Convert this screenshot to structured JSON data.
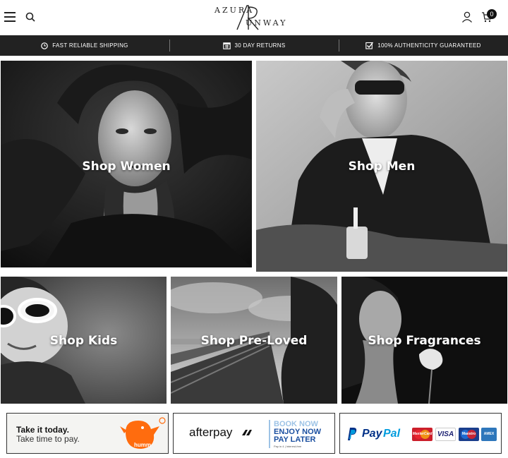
{
  "header": {
    "logo_top": "AZURA",
    "logo_bottom": "UNWAY",
    "logo_letters": "AR",
    "cart_count": "0"
  },
  "promo": [
    {
      "label": "FAST RELIABLE SHIPPING",
      "icon": "clock-icon"
    },
    {
      "label": "30 DAY RETURNS",
      "icon": "calendar-icon"
    },
    {
      "label": "100% AUTHENTICITY GUARANTEED",
      "icon": "checkbox-icon"
    }
  ],
  "tiles": [
    {
      "label": "Shop Women"
    },
    {
      "label": "Shop Men"
    },
    {
      "label": "Shop Kids"
    },
    {
      "label": "Shop Pre-Loved"
    },
    {
      "label": "Shop Fragrances"
    }
  ],
  "payments": {
    "humm": {
      "line1": "Take it today.",
      "line2": "Take time to pay.",
      "brand": "humm",
      "color": "#ff6c0e"
    },
    "afterpay": {
      "brand": "afterpay",
      "line1": "BOOK NOW",
      "line2": "ENJOY NOW",
      "line3": "PAY LATER",
      "fine": "Pay in 4 | Interest-free",
      "accent": "#1a4fa0",
      "accent_light": "#9dc3e6"
    },
    "paypal": {
      "brand_a": "Pay",
      "brand_b": "Pal",
      "cards": [
        "MasterCard",
        "VISA",
        "Maestro",
        "AMEX"
      ],
      "color_dark": "#003087",
      "color_light": "#009cde"
    }
  }
}
